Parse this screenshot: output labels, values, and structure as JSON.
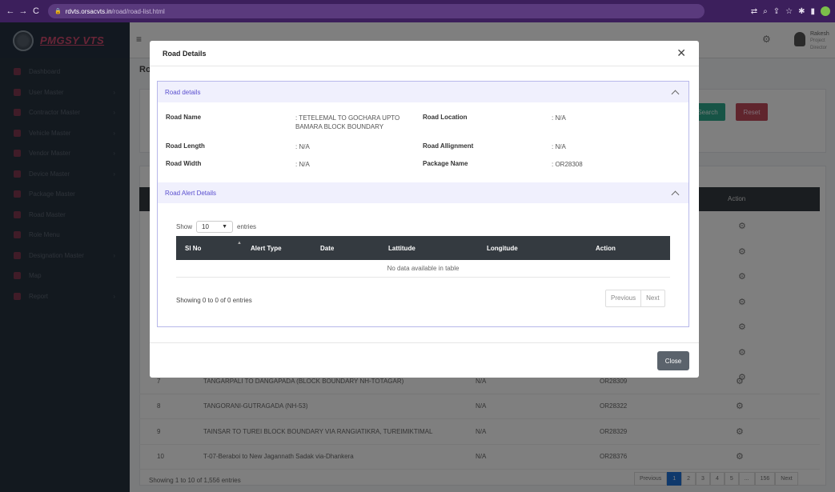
{
  "browser": {
    "url_host": "rdvts.orsacvts.in",
    "url_path": "/road/road-list.html"
  },
  "sidebar": {
    "brand": "PMGSY VTS",
    "items": [
      {
        "label": "Dashboard",
        "has_children": false
      },
      {
        "label": "User Master",
        "has_children": true
      },
      {
        "label": "Contractor Master",
        "has_children": true
      },
      {
        "label": "Vehicle Master",
        "has_children": true
      },
      {
        "label": "Vendor Master",
        "has_children": true
      },
      {
        "label": "Device Master",
        "has_children": true
      },
      {
        "label": "Package Master",
        "has_children": false
      },
      {
        "label": "Road Master",
        "has_children": false
      },
      {
        "label": "Role Menu",
        "has_children": false
      },
      {
        "label": "Designation Master",
        "has_children": true
      },
      {
        "label": "Map",
        "has_children": false
      },
      {
        "label": "Report",
        "has_children": true
      }
    ]
  },
  "topbar": {
    "user_name": "Rakesh",
    "user_role": "Project Director"
  },
  "page": {
    "title": "Ro",
    "search_label": "Search",
    "reset_label": "Reset",
    "action_header": "Action",
    "rows": [
      {
        "sl": "7",
        "name": "TANGARPALI TO DANGAPADA (BLOCK BOUNDARY NH-TOTAGAR)",
        "location": "N/A",
        "package": "OR28309"
      },
      {
        "sl": "8",
        "name": "TANGORANI-GUTRAGADA (NH-53)",
        "location": "N/A",
        "package": "OR28322"
      },
      {
        "sl": "9",
        "name": "TAINSAR TO TUREI BLOCK BOUNDARY VIA RANGIATIKRA, TUREIMIKTIMAL",
        "location": "N/A",
        "package": "OR28329"
      },
      {
        "sl": "10",
        "name": "T-07-Beraboi to New Jagannath Sadak via-Dhankera",
        "location": "N/A",
        "package": "OR28376"
      }
    ],
    "footer_info": "Showing 1 to 10 of 1,556 entries",
    "pager": {
      "prev": "Previous",
      "pages": [
        "1",
        "2",
        "3",
        "4",
        "5",
        "...",
        "156"
      ],
      "next": "Next"
    }
  },
  "modal": {
    "title": "Road Details",
    "road_details_header": "Road details",
    "labels": {
      "road_name": "Road Name",
      "road_location": "Road Location",
      "road_length": "Road Length",
      "road_allignment": "Road Allignment",
      "road_width": "Road Width",
      "package_name": "Package Name"
    },
    "values": {
      "road_name": ": TETELEMAL TO GOCHARA UPTO BAMARA BLOCK BOUNDARY",
      "road_location": ": N/A",
      "road_length": ": N/A",
      "road_allignment": ": N/A",
      "road_width": ": N/A",
      "package_name": ": OR28308"
    },
    "alert_header": "Road Alert Details",
    "show_label": "Show",
    "entries_value": "10",
    "entries_label": "entries",
    "columns": [
      "Sl No",
      "Alert Type",
      "Date",
      "Lattitude",
      "Longitude",
      "Action"
    ],
    "empty_text": "No data available in table",
    "info_text": "Showing 0 to 0 of 0 entries",
    "prev_label": "Previous",
    "next_label": "Next",
    "close_label": "Close"
  }
}
